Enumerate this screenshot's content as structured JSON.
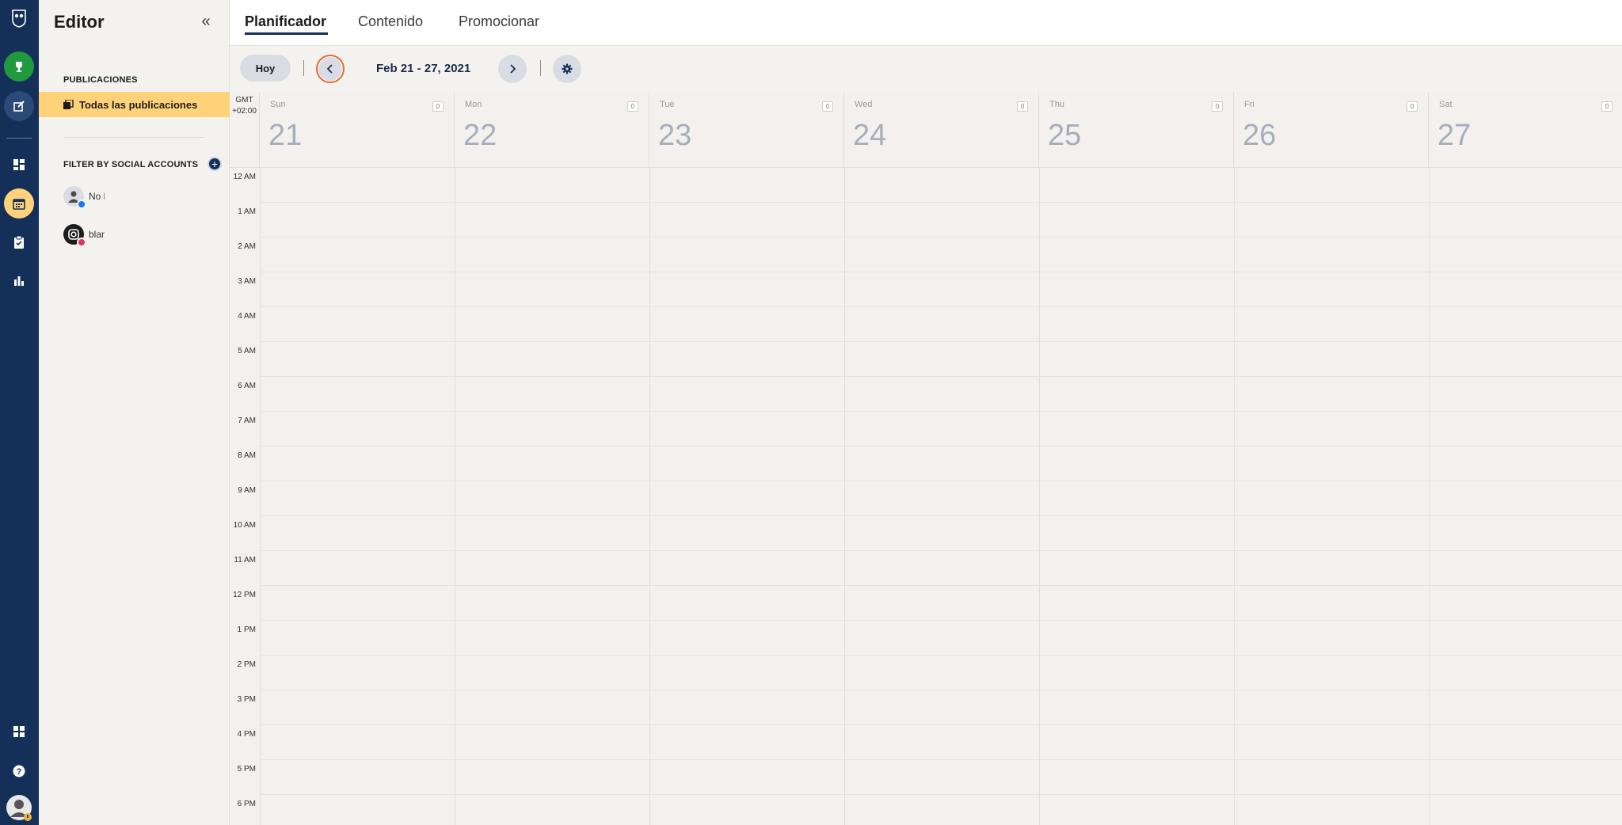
{
  "rail": {
    "items": [
      {
        "name": "owl-logo-icon"
      },
      {
        "name": "trophy-icon"
      },
      {
        "name": "compose-icon"
      },
      {
        "name": "dashboard-icon"
      },
      {
        "name": "calendar-icon"
      },
      {
        "name": "clipboard-icon"
      },
      {
        "name": "analytics-icon"
      },
      {
        "name": "apps-icon"
      },
      {
        "name": "help-icon"
      },
      {
        "name": "profile-icon"
      }
    ]
  },
  "sidebar": {
    "title": "Editor",
    "section_label": "PUBLICACIONES",
    "active_item": "Todas las publicaciones",
    "filter_label": "FILTER BY SOCIAL ACCOUNTS",
    "accounts": [
      {
        "name": "No l",
        "network_color": "#1877f2"
      },
      {
        "name": "blan",
        "network_color": "#e1306c"
      }
    ]
  },
  "tabs": [
    {
      "label": "Planificador",
      "active": true
    },
    {
      "label": "Contenido",
      "active": false
    },
    {
      "label": "Promocionar",
      "active": false
    }
  ],
  "toolbar": {
    "today_label": "Hoy",
    "date_range": "Feb 21 - 27, 2021"
  },
  "calendar": {
    "timezone_line1": "GMT",
    "timezone_line2": "+02:00",
    "days": [
      {
        "name": "Sun",
        "num": "21",
        "count": "0"
      },
      {
        "name": "Mon",
        "num": "22",
        "count": "0"
      },
      {
        "name": "Tue",
        "num": "23",
        "count": "0"
      },
      {
        "name": "Wed",
        "num": "24",
        "count": "0"
      },
      {
        "name": "Thu",
        "num": "25",
        "count": "0"
      },
      {
        "name": "Fri",
        "num": "26",
        "count": "0"
      },
      {
        "name": "Sat",
        "num": "27",
        "count": "0"
      }
    ],
    "hours": [
      "12 AM",
      "1 AM",
      "2 AM",
      "3 AM",
      "4 AM",
      "5 AM",
      "6 AM",
      "7 AM",
      "8 AM",
      "9 AM",
      "10 AM",
      "11 AM",
      "12 PM",
      "1 PM",
      "2 PM",
      "3 PM",
      "4 PM",
      "5 PM",
      "6 PM"
    ]
  },
  "colors": {
    "rail": "#143059",
    "accent_active": "#ffd27a",
    "focus_ring": "#e36b2c"
  }
}
